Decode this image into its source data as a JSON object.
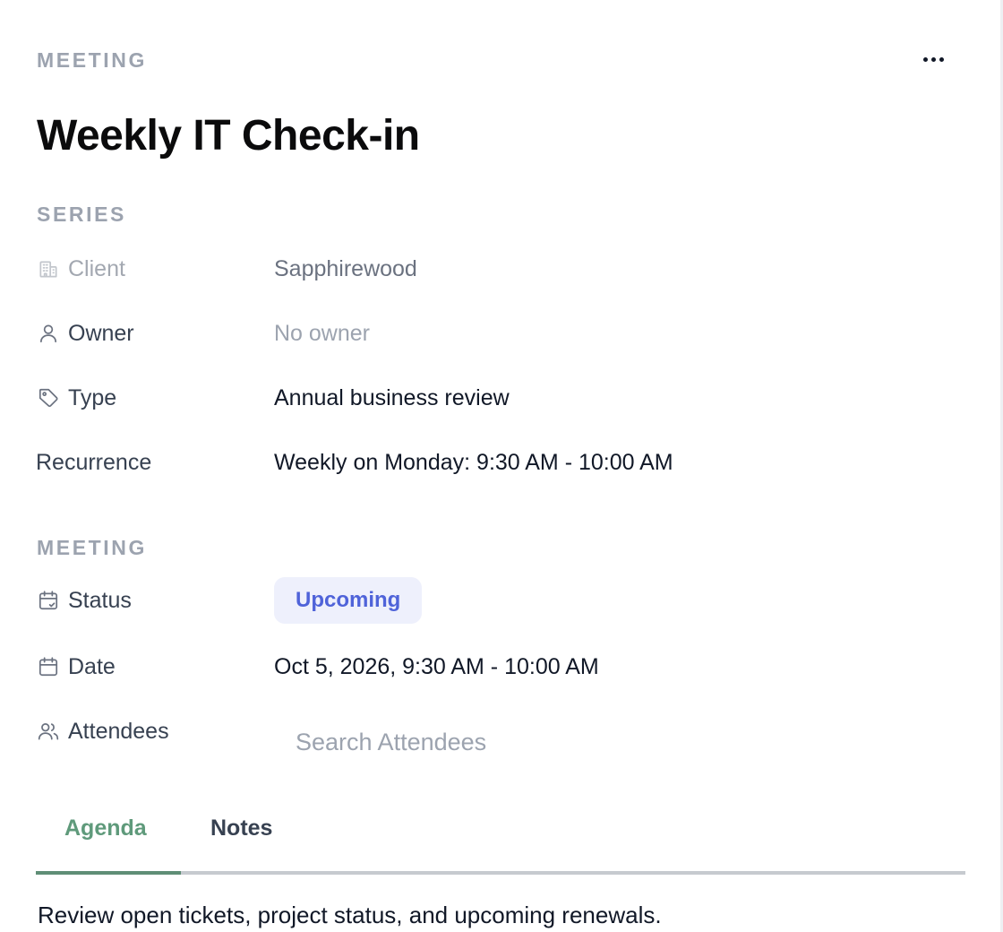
{
  "header": {
    "eyebrow": "MEETING",
    "title": "Weekly IT Check-in",
    "more_icon": "more-horizontal-icon"
  },
  "series": {
    "heading": "SERIES",
    "client": {
      "label": "Client",
      "value": "Sapphirewood",
      "icon": "building-icon"
    },
    "owner": {
      "label": "Owner",
      "value": "No owner",
      "icon": "user-icon"
    },
    "type": {
      "label": "Type",
      "value": "Annual business review",
      "icon": "tag-icon"
    },
    "recurrence": {
      "label": "Recurrence",
      "value": "Weekly on Monday: 9:30 AM - 10:00 AM"
    }
  },
  "meeting": {
    "heading": "MEETING",
    "status": {
      "label": "Status",
      "value": "Upcoming",
      "icon": "calendar-check-icon",
      "badge_color": "#4f63d9",
      "badge_bg": "#eef0fc"
    },
    "date": {
      "label": "Date",
      "value": "Oct 5, 2026, 9:30 AM - 10:00 AM",
      "icon": "calendar-icon"
    },
    "attendees": {
      "label": "Attendees",
      "placeholder": "Search Attendees",
      "value": "",
      "icon": "users-icon"
    }
  },
  "tabs": {
    "items": [
      {
        "label": "Agenda",
        "active": true
      },
      {
        "label": "Notes",
        "active": false
      }
    ],
    "active_color": "#5f9a7b"
  },
  "agenda": {
    "text": "Review open tickets, project status, and upcoming renewals."
  }
}
